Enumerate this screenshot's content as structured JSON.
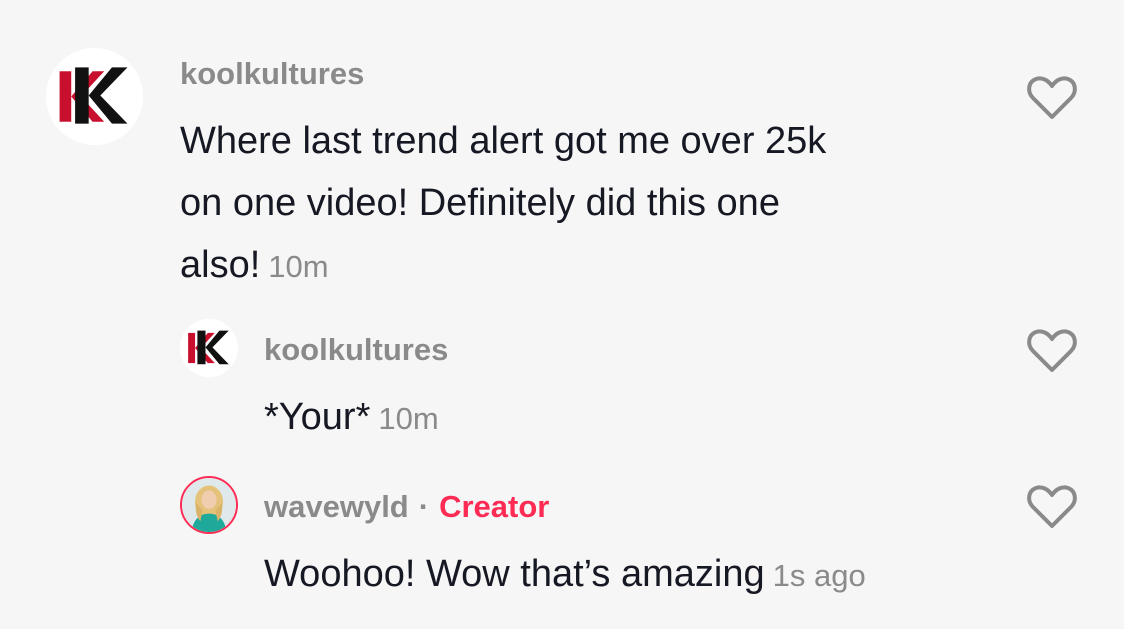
{
  "comments": [
    {
      "username": "koolkultures",
      "lines": [
        "Where last trend alert got me over 25k",
        "on one video! Definitely did this one",
        "also!"
      ],
      "time": "10m",
      "avatar_icon": "kk-logo-icon"
    },
    {
      "username": "koolkultures",
      "text": "*Your*",
      "time": "10m",
      "avatar_icon": "kk-logo-icon"
    },
    {
      "username": "wavewyld",
      "separator": "·",
      "badge": "Creator",
      "text": "Woohoo! Wow that’s amazing",
      "time": "1s ago",
      "avatar_icon": "profile-photo"
    }
  ],
  "colors": {
    "background": "#f6f6f6",
    "username": "#8a8a8a",
    "body_text": "#161823",
    "creator_badge": "#fe2c55",
    "logo_red": "#c8102e",
    "logo_black": "#111111"
  },
  "icons": {
    "like": "heart-outline-icon"
  }
}
